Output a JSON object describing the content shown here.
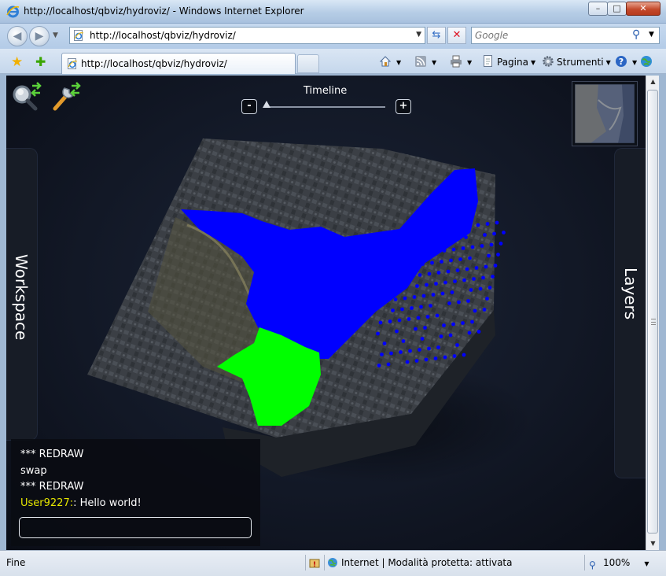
{
  "window": {
    "title": "http://localhost/qbviz/hydroviz/ - Windows Internet Explorer",
    "minimize_glyph": "–",
    "maximize_glyph": "□",
    "close_glyph": "✕"
  },
  "address_bar": {
    "url": "http://localhost/qbviz/hydroviz/",
    "search_placeholder": "Google"
  },
  "tab": {
    "title": "http://localhost/qbviz/hydroviz/"
  },
  "command_bar": {
    "page_label": "Pagina",
    "tools_label": "Strumenti"
  },
  "viewer": {
    "timeline_label": "Timeline",
    "timeline_minus": "-",
    "timeline_plus": "+",
    "workspace_label": "Workspace",
    "layers_label": "Layers",
    "colors": {
      "background": "#121826",
      "water_depth": "#0000ff",
      "inflow": "#00ff00"
    }
  },
  "console": {
    "lines": [
      "*** REDRAW",
      "swap",
      "*** REDRAW"
    ],
    "message": {
      "user": "User9227:",
      "text": ": Hello world!"
    },
    "input_value": ""
  },
  "status_bar": {
    "status": "Fine",
    "zone": "Internet | Modalità protetta: attivata",
    "zoom": "100%"
  },
  "icons": [
    "ie-logo-icon",
    "back-icon",
    "forward-icon",
    "page-icon",
    "refresh-icon",
    "stop-icon",
    "search-icon",
    "favorites-star-icon",
    "add-favorites-icon",
    "home-icon",
    "feeds-icon",
    "print-icon",
    "page-icon",
    "tools-gear-icon",
    "help-icon",
    "research-icon",
    "magnifier-toggle-icon",
    "wrench-toggle-icon",
    "security-warning-icon",
    "globe-icon",
    "zoom-icon"
  ]
}
